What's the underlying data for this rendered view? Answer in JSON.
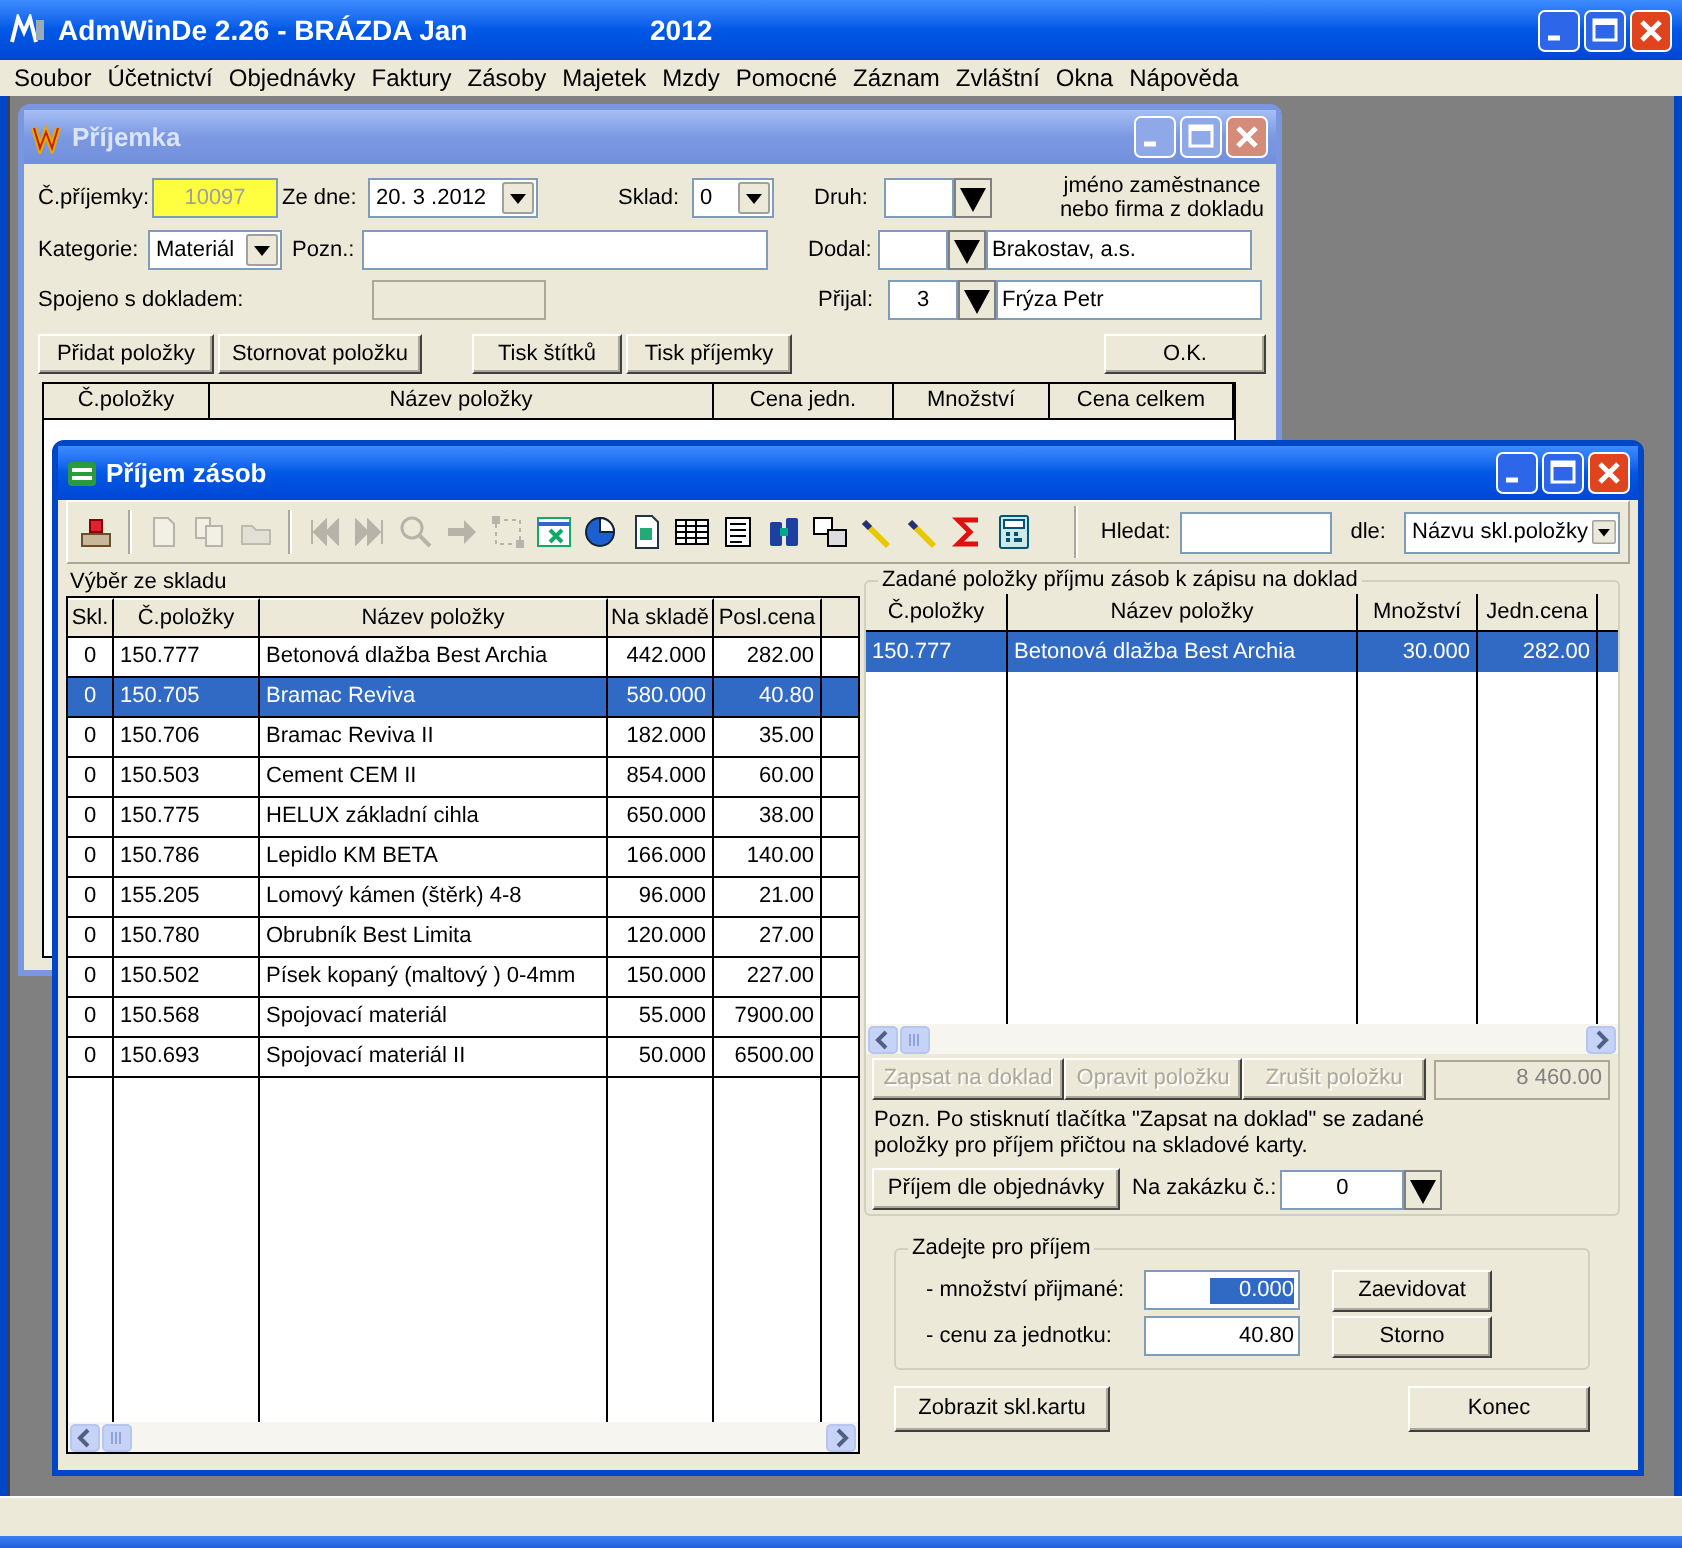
{
  "app": {
    "title": "AdmWinDe 2.26 - BRÁZDA Jan",
    "year": "2012"
  },
  "menu": [
    "Soubor",
    "Účetnictví",
    "Objednávky",
    "Faktury",
    "Zásoby",
    "Majetek",
    "Mzdy",
    "Pomocné",
    "Záznam",
    "Zvláštní",
    "Okna",
    "Nápověda"
  ],
  "receipt": {
    "title": "Příjemka",
    "active": false,
    "number": {
      "label": "Č.příjemky:",
      "value": "10097"
    },
    "date": {
      "label": "Ze dne:",
      "value": "20. 3 .2012"
    },
    "warehouse": {
      "label": "Sklad:",
      "value": "0"
    },
    "type": {
      "label": "Druh:"
    },
    "hint": [
      "jméno zaměstnance",
      "nebo firma z dokladu"
    ],
    "category": {
      "label": "Kategorie:",
      "value": "Materiál"
    },
    "note": {
      "label": "Pozn.:"
    },
    "supplier": {
      "label": "Dodal:",
      "name": "Brakostav, a.s."
    },
    "linked": {
      "label": "Spojeno s dokladem:"
    },
    "received_by": {
      "label": "Přijal:",
      "value": "3",
      "name": "Frýza Petr"
    },
    "buttons": [
      "Přidat položky",
      "Stornovat položku",
      "Tisk štítků",
      "Tisk příjemky",
      "O.K."
    ],
    "columns": [
      "Č.položky",
      "Název položky",
      "Cena jedn.",
      "Množství",
      "Cena celkem"
    ]
  },
  "stock_receipt": {
    "title": "Příjem zásob",
    "active": true,
    "toolbar": [
      {
        "kind": "tray",
        "disabled": false
      },
      {
        "kind": "separator"
      },
      {
        "kind": "document",
        "disabled": true
      },
      {
        "kind": "copy",
        "disabled": true
      },
      {
        "kind": "folder",
        "disabled": true
      },
      {
        "kind": "separator"
      },
      {
        "kind": "first",
        "disabled": true
      },
      {
        "kind": "last",
        "disabled": true
      },
      {
        "kind": "search",
        "disabled": true
      },
      {
        "kind": "arrow",
        "disabled": true
      },
      {
        "kind": "selection",
        "disabled": true
      },
      {
        "kind": "spreadsheet",
        "disabled": false
      },
      {
        "kind": "pie",
        "disabled": false
      },
      {
        "kind": "page",
        "disabled": false
      },
      {
        "kind": "table",
        "disabled": false
      },
      {
        "kind": "list",
        "disabled": false
      },
      {
        "kind": "binoculars",
        "disabled": false
      },
      {
        "kind": "windows",
        "disabled": false
      },
      {
        "kind": "wand",
        "disabled": false
      },
      {
        "kind": "wand",
        "disabled": false
      },
      {
        "kind": "sigma",
        "disabled": false
      },
      {
        "kind": "calculator",
        "disabled": false
      }
    ],
    "search": {
      "label": "Hledat:",
      "by_label": "dle:",
      "by_value": "Názvu skl.položky"
    },
    "stock": {
      "title": "Výběr ze skladu",
      "columns": [
        "Skl.",
        "Č.položky",
        "Název položky",
        "Na skladě",
        "Posl.cena"
      ],
      "rows": [
        {
          "cells": [
            "0",
            "150.777",
            "Betonová dlažba Best Archia",
            "442.000",
            "282.00"
          ],
          "selected": false
        },
        {
          "cells": [
            "0",
            "150.705",
            "Bramac Reviva",
            "580.000",
            "40.80"
          ],
          "selected": true
        },
        {
          "cells": [
            "0",
            "150.706",
            "Bramac Reviva II",
            "182.000",
            "35.00"
          ],
          "selected": false
        },
        {
          "cells": [
            "0",
            "150.503",
            "Cement CEM II",
            "854.000",
            "60.00"
          ],
          "selected": false
        },
        {
          "cells": [
            "0",
            "150.775",
            "HELUX základní cihla",
            "650.000",
            "38.00"
          ],
          "selected": false
        },
        {
          "cells": [
            "0",
            "150.786",
            "Lepidlo KM BETA",
            "166.000",
            "140.00"
          ],
          "selected": false
        },
        {
          "cells": [
            "0",
            "155.205",
            "Lomový kámen (štěrk) 4-8",
            "96.000",
            "21.00"
          ],
          "selected": false
        },
        {
          "cells": [
            "0",
            "150.780",
            "Obrubník Best Limita",
            "120.000",
            "27.00"
          ],
          "selected": false
        },
        {
          "cells": [
            "0",
            "150.502",
            "Písek kopaný (maltový ) 0-4mm",
            "150.000",
            "227.00"
          ],
          "selected": false
        },
        {
          "cells": [
            "0",
            "150.568",
            "Spojovací materiál",
            "55.000",
            "7900.00"
          ],
          "selected": false
        },
        {
          "cells": [
            "0",
            "150.693",
            "Spojovací materiál II",
            "50.000",
            "6500.00"
          ],
          "selected": false
        }
      ]
    },
    "entered": {
      "title": "Zadané položky příjmu zásob k zápisu na doklad",
      "columns": [
        "Č.položky",
        "Název položky",
        "Množství",
        "Jedn.cena"
      ],
      "rows": [
        {
          "cells": [
            "150.777",
            "Betonová dlažba Best Archia",
            "30.000",
            "282.00"
          ],
          "selected": true
        }
      ]
    },
    "actions": [
      {
        "label": "Zapsat na doklad",
        "disabled": true
      },
      {
        "label": "Opravit položku",
        "disabled": true
      },
      {
        "label": "Zrušit položku",
        "disabled": true
      }
    ],
    "total": "8 460.00",
    "note": "Pozn. Po stisknutí tlačítka \"Zapsat na doklad\" se zadané položky pro příjem přičtou na skladové karty.",
    "order_button": "Příjem dle objednávky",
    "job": {
      "label": "Na zakázku č.:",
      "value": "0"
    },
    "entry": {
      "title": "Zadejte pro příjem",
      "quantity": {
        "label": "- množství přijmané:",
        "value": "0.000",
        "selected": true
      },
      "price": {
        "label": "- cenu za jednotku:",
        "value": "40.80",
        "selected": false
      },
      "buttons": [
        "Zaevidovat",
        "Storno"
      ]
    },
    "card_button": "Zobrazit skl.kartu",
    "close_button": "Konec"
  }
}
